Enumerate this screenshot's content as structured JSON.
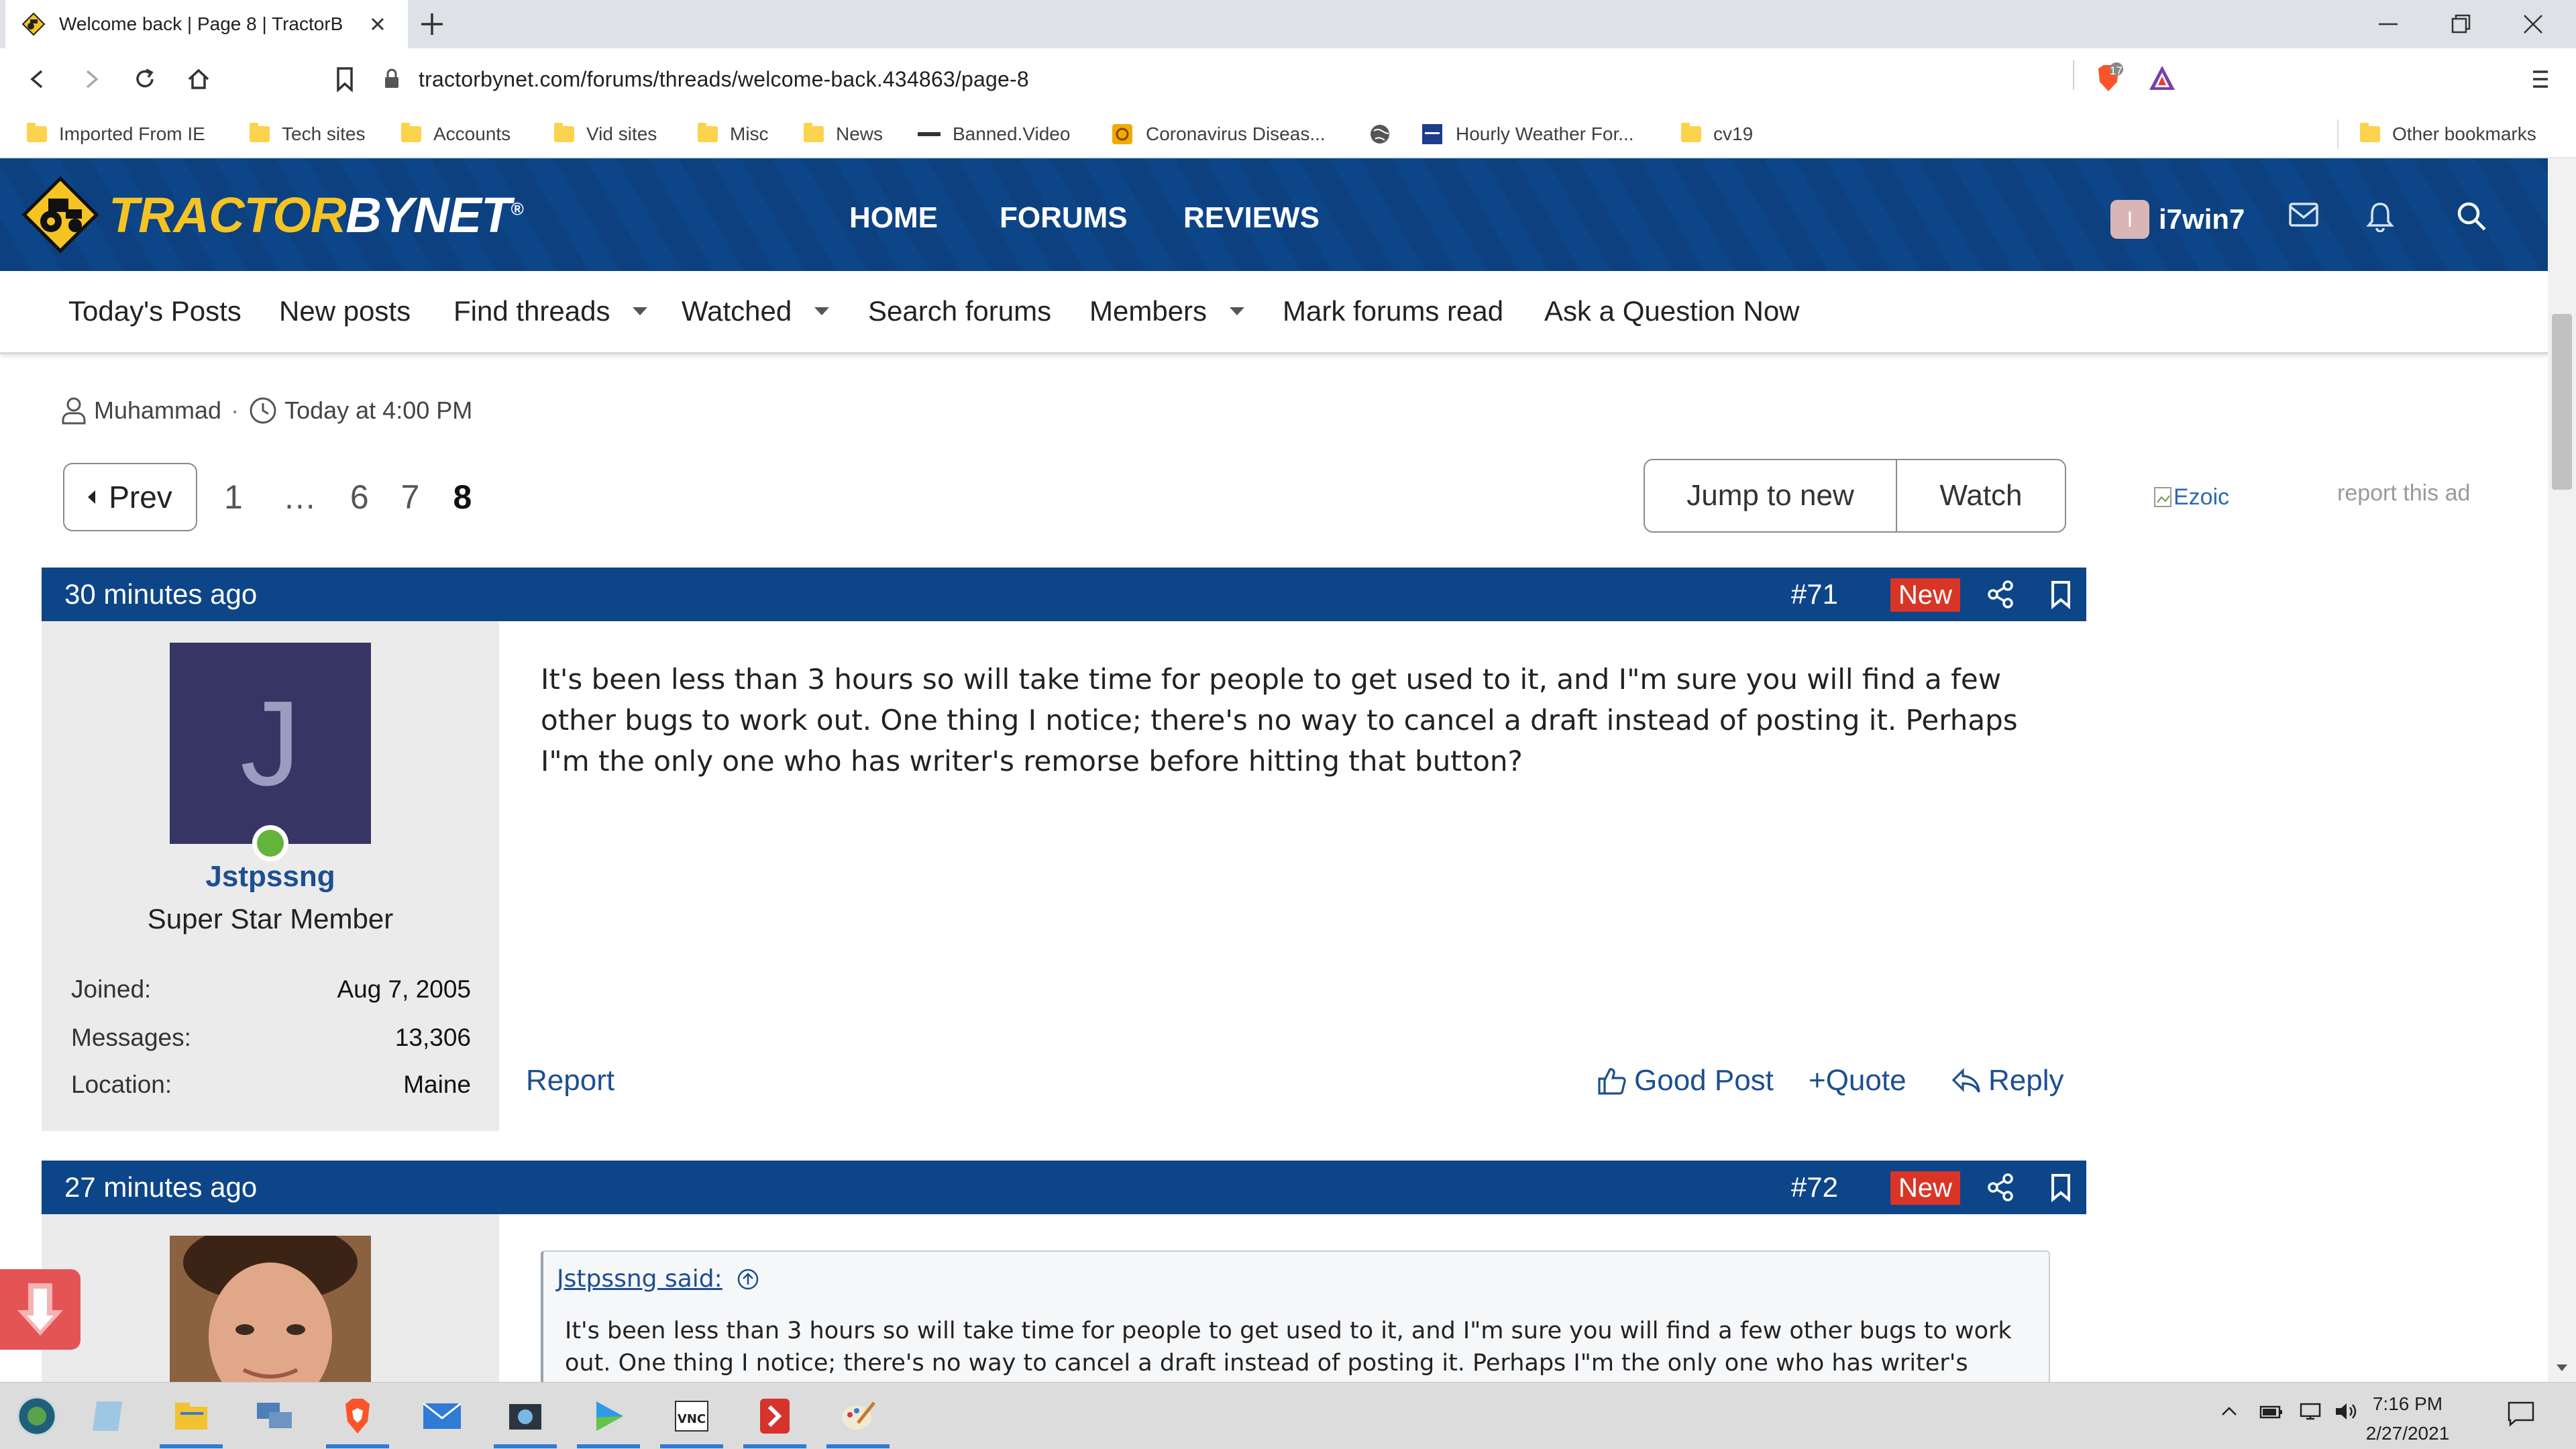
{
  "browser": {
    "tab_title": "Welcome back | Page 8 | TractorB",
    "url": "tractorbynet.com/forums/threads/welcome-back.434863/page-8",
    "brave_count": "17"
  },
  "bookmarks": {
    "items": [
      "Imported From IE",
      "Tech sites",
      "Accounts",
      "Vid sites",
      "Misc",
      "News",
      "Banned.Video",
      "Coronavirus Diseas...",
      "Hourly Weather For...",
      "cv19"
    ],
    "other": "Other bookmarks"
  },
  "site": {
    "logo_first": "TRACTOR",
    "logo_second": "BYNET",
    "logo_mark": "®",
    "nav": [
      "HOME",
      "FORUMS",
      "REVIEWS"
    ],
    "user_initial": "I",
    "username": "i7win7"
  },
  "subnav": [
    "Today's Posts",
    "New posts",
    "Find threads",
    "Watched",
    "Search forums",
    "Members",
    "Mark forums read",
    "Ask a Question Now"
  ],
  "thread": {
    "author": "Muhammad",
    "time": "Today at 4:00 PM",
    "pager": {
      "prev": "Prev",
      "pages": [
        "1",
        "…",
        "6",
        "7",
        "8"
      ],
      "current": "8"
    },
    "jump_to_new": "Jump to new",
    "watch": "Watch",
    "ad_alt": "Ezoic",
    "report_ad": "report this ad"
  },
  "posts": [
    {
      "time": "30 minutes ago",
      "number": "#71",
      "badge": "New",
      "avatar_letter": "J",
      "username": "Jstpssng",
      "user_title": "Super Star Member",
      "stats": [
        {
          "label": "Joined:",
          "value": "Aug 7, 2005"
        },
        {
          "label": "Messages:",
          "value": "13,306"
        },
        {
          "label": "Location:",
          "value": "Maine"
        }
      ],
      "text": "It's been less than 3 hours so will take time for people to get used to it, and I\"m sure you will find a few other bugs to work out. One thing I notice; there's no way to cancel a draft instead of posting it. Perhaps I\"m the only one who has writer's remorse before hitting that button?",
      "actions": {
        "report": "Report",
        "good": "Good Post",
        "quote": "+Quote",
        "reply": "Reply"
      }
    },
    {
      "time": "27 minutes ago",
      "number": "#72",
      "badge": "New",
      "quote_author": "Jstpssng said:",
      "quote_text": "It's been less than 3 hours so will take time for people to get used to it, and I\"m sure you will find a few other bugs to work out. One thing I notice; there's no way to cancel a draft instead of posting it. Perhaps I\"m the only one who has writer's"
    }
  ],
  "taskbar": {
    "time": "7:16 PM",
    "date": "2/27/2021"
  },
  "colors": {
    "brand": "#0d4589",
    "accent": "#f6c324",
    "new_badge": "#d83527",
    "link": "#1d4f91"
  }
}
